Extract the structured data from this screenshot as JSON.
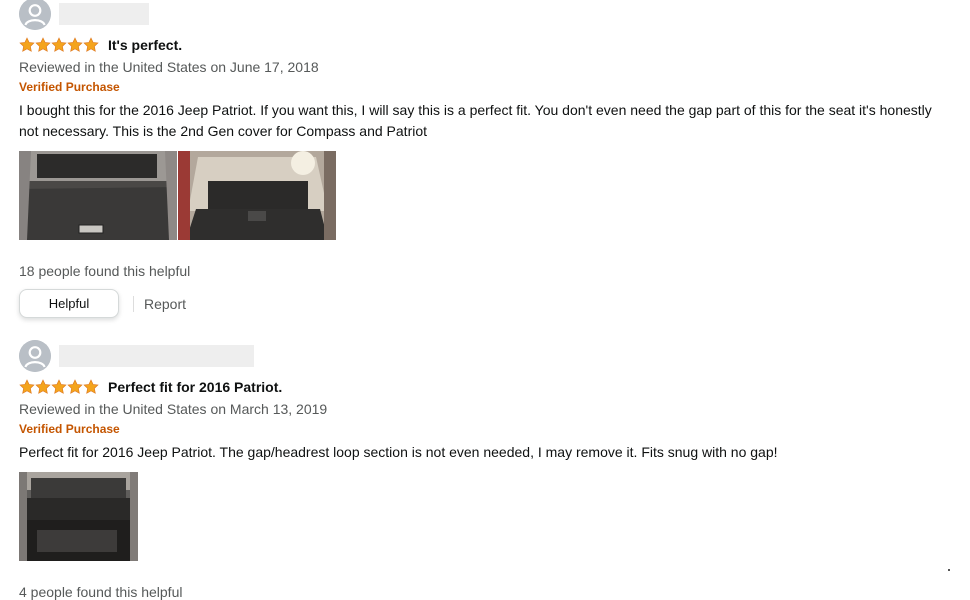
{
  "colors": {
    "star": "#f4a41d",
    "verified": "#c45500",
    "muted_text": "#565959",
    "body_text": "#0f1111"
  },
  "reviews": [
    {
      "rating": 5,
      "title": "It's perfect.",
      "date": "Reviewed in the United States on June 17, 2018",
      "verified": "Verified Purchase",
      "body": "I bought this for the 2016 Jeep Patriot. If you want this, I will say this is a perfect fit. You don't even need the gap part of this for the seat it's honestly not necessary. This is the 2nd Gen cover for Compass and Patriot",
      "image_count": 2,
      "helpful_count": "18 people found this helpful",
      "helpful_label": "Helpful",
      "report_label": "Report"
    },
    {
      "rating": 5,
      "title": "Perfect fit for 2016 Patriot.",
      "date": "Reviewed in the United States on March 13, 2019",
      "verified": "Verified Purchase",
      "body": "Perfect fit for 2016 Jeep Patriot. The gap/headrest loop section is not even needed, I may remove it. Fits snug with no gap!",
      "image_count": 1,
      "helpful_count": "4 people found this helpful"
    }
  ],
  "icons": {
    "avatar": "user-avatar-icon",
    "star": "star-icon"
  }
}
